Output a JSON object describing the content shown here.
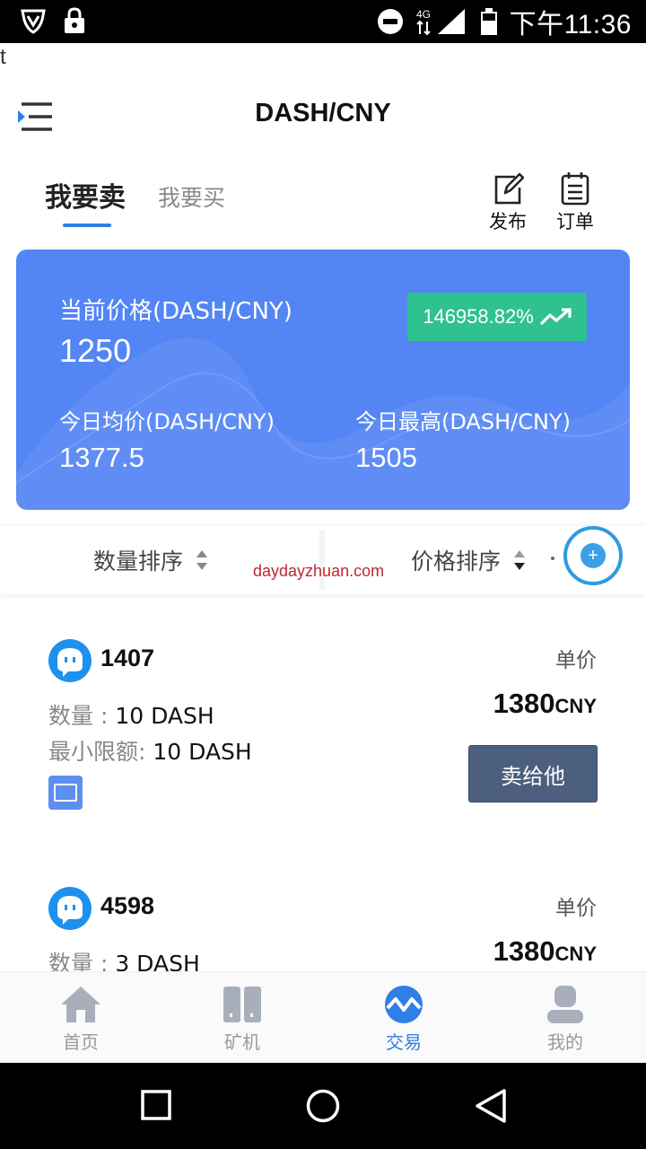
{
  "status_bar": {
    "network": "4G",
    "time": "下午11:36"
  },
  "stray_text": "t",
  "header": {
    "title": "DASH/CNY"
  },
  "tabs": {
    "sell": "我要卖",
    "buy": "我要买"
  },
  "actions": {
    "publish": "发布",
    "orders": "订单"
  },
  "price_card": {
    "current_label": "当前价格(DASH/CNY)",
    "current_value": "1250",
    "change": "146958.82%",
    "avg_label": "今日均价(DASH/CNY)",
    "avg_value": "1377.5",
    "high_label": "今日最高(DASH/CNY)",
    "high_value": "1505"
  },
  "sort": {
    "quantity": "数量排序",
    "price": "价格排序"
  },
  "watermark": "daydayzhuan.com",
  "listings": [
    {
      "user": "1407",
      "qty_label": "数量 : ",
      "qty_value": "10 DASH",
      "min_label": "最小限额: ",
      "min_value": "10 DASH",
      "unit_label": "单价",
      "price": "1380",
      "currency": "CNY",
      "button": "卖给他"
    },
    {
      "user": "4598",
      "qty_label": "数量 : ",
      "qty_value": "3 DASH",
      "unit_label": "单价",
      "price": "1380",
      "currency": "CNY"
    }
  ],
  "bottom_nav": [
    {
      "label": "首页",
      "icon": "home-icon"
    },
    {
      "label": "矿机",
      "icon": "miner-icon"
    },
    {
      "label": "交易",
      "icon": "trade-icon",
      "active": true
    },
    {
      "label": "我的",
      "icon": "profile-icon"
    }
  ],
  "colors": {
    "accent": "#2f7fe6",
    "card_bg": "#5385f5",
    "badge_green": "#2fc18f",
    "sell_button": "#4c5f7e"
  }
}
